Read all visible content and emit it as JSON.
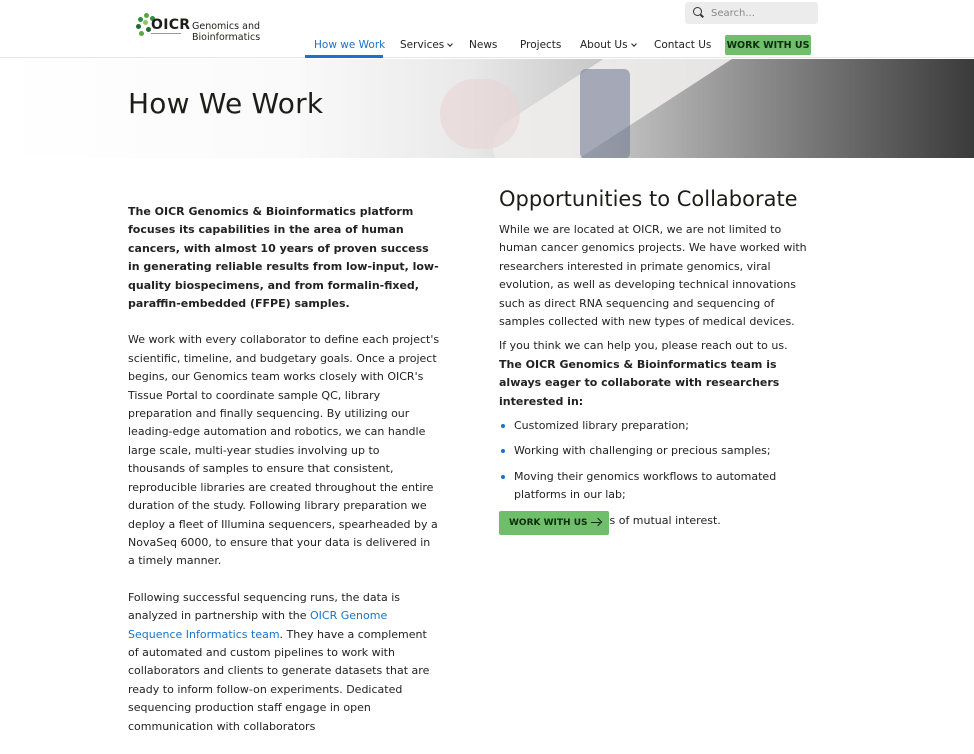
{
  "header": {
    "logo_text": "OICR",
    "logo_title": "Genomics and Bioinformatics",
    "search_placeholder": "Search...",
    "nav": [
      {
        "label": "How we Work",
        "active": true
      },
      {
        "label": "Services",
        "has_dropdown": true
      },
      {
        "label": "News"
      },
      {
        "label": "Projects"
      },
      {
        "label": "About Us",
        "has_dropdown": true
      },
      {
        "label": "Contact Us"
      }
    ],
    "work_with_us_label": "WORK WITH US"
  },
  "hero": {
    "title": "How We Work"
  },
  "left": {
    "lead": "The OICR Genomics & Bioinformatics platform focuses its capabilities in the area of human cancers, with almost 10 years of proven success in generating reliable results from low-input, low-quality biospecimens, and from formalin-fixed, paraffin-embedded (FFPE) samples.",
    "p1": "We work with every collaborator to define each project's scientific, timeline, and budgetary goals. Once a project begins, our Genomics team works closely with OICR's Tissue Portal to coordinate sample QC, library preparation and finally sequencing. By utilizing our leading-edge automation and robotics, we can handle large scale, multi-year studies involving up to thousands of samples to ensure that consistent, reproducible libraries are created throughout the entire duration of the study. Following library preparation we deploy a fleet of Illumina sequencers, spearheaded by a NovaSeq 6000, to ensure that your data is delivered in a timely manner.",
    "p2_before": "Following successful sequencing runs, the data is analyzed in partnership with the ",
    "p2_link": "OICR Genome Sequence Informatics team",
    "p2_after": ". They have a complement of automated and custom pipelines to work with collaborators and clients to generate datasets that are ready to inform follow-on experiments. Dedicated sequencing production staff engage in open communication with collaborators"
  },
  "right": {
    "heading": "Opportunities to Collaborate",
    "p1": "While we are located at OICR, we are not limited to human cancer genomics projects. We have worked with researchers interested in primate genomics, viral evolution, as well as developing technical innovations such as direct RNA sequencing and sequencing of samples collected with new types of medical devices.",
    "p2": "If you think we can help you, please reach out to us.",
    "p3": "The OICR Genomics & Bioinformatics team is always eager to collaborate with researchers interested in:",
    "list": [
      "Customized library preparation;",
      "Working with challenging or precious samples;",
      "Moving their genomics workflows to automated platforms in our lab;",
      "Any other projects of mutual interest."
    ],
    "cta_label": "WORK WITH US"
  },
  "colors": {
    "accent_blue": "#1a73c6",
    "button_green": "#6ebe6a"
  }
}
